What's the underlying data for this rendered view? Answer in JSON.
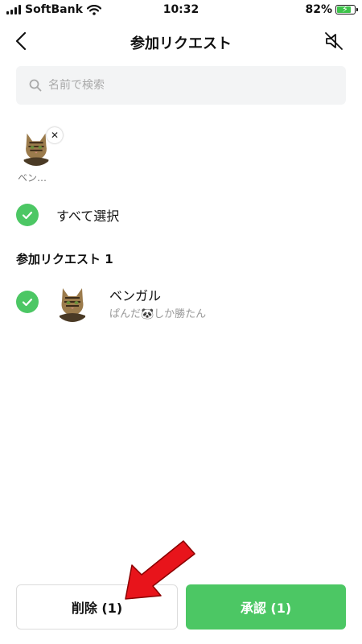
{
  "status_bar": {
    "carrier": "SoftBank",
    "time": "10:32",
    "battery": "82%",
    "battery_level": 0.82
  },
  "nav": {
    "title": "参加リクエスト"
  },
  "search": {
    "placeholder": "名前で検索"
  },
  "selected": [
    {
      "name": "ベン…"
    }
  ],
  "select_all": {
    "label": "すべて選択"
  },
  "section": {
    "title": "参加リクエスト 1"
  },
  "requests": [
    {
      "name": "ベンガル",
      "sub": "ぱんだ🐼しか勝たん"
    }
  ],
  "buttons": {
    "delete": "削除 (1)",
    "approve": "承認 (1)"
  },
  "colors": {
    "accent": "#4cc764",
    "annotation": "#e8141b"
  }
}
